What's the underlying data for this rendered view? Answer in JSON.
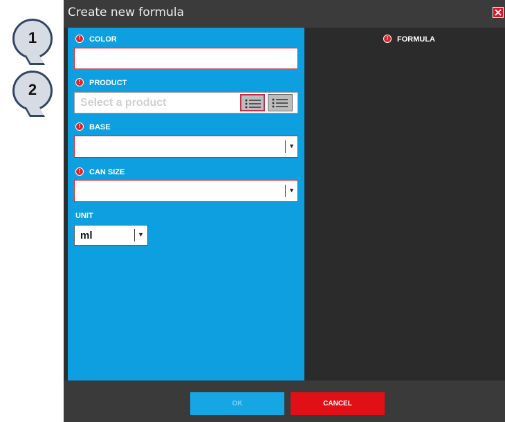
{
  "dialog": {
    "title": "Create new formula"
  },
  "form": {
    "color_label": "COLOR",
    "color_value": "",
    "product_label": "PRODUCT",
    "product_placeholder": "Select a product",
    "base_label": "BASE",
    "base_value": "",
    "can_size_label": "CAN SIZE",
    "can_size_value": "",
    "unit_label": "UNIT",
    "unit_value": "ml"
  },
  "formula": {
    "label": "FORMULA"
  },
  "buttons": {
    "ok": "OK",
    "cancel": "CANCEL"
  },
  "callouts": [
    "1",
    "2"
  ],
  "colors": {
    "left_panel": "#0e9fe0",
    "dialog_bg": "#2d2d2d",
    "error_red": "#d9232d",
    "cancel_red": "#e01016"
  },
  "icons": {
    "warning": "warning-icon",
    "list": "list-icon",
    "close": "close-icon",
    "dropdown": "chevron-down-icon"
  }
}
